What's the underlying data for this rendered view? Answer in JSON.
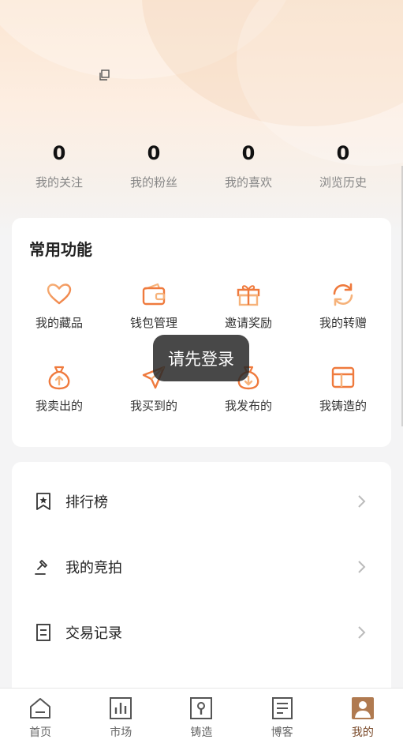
{
  "stats": [
    {
      "value": "0",
      "label": "我的关注"
    },
    {
      "value": "0",
      "label": "我的粉丝"
    },
    {
      "value": "0",
      "label": "我的喜欢"
    },
    {
      "value": "0",
      "label": "浏览历史"
    }
  ],
  "functions": {
    "title": "常用功能",
    "items": [
      {
        "label": "我的藏品",
        "icon": "heart-icon"
      },
      {
        "label": "钱包管理",
        "icon": "wallet-icon"
      },
      {
        "label": "邀请奖励",
        "icon": "gift-icon"
      },
      {
        "label": "我的转赠",
        "icon": "transfer-icon"
      },
      {
        "label": "我卖出的",
        "icon": "sold-bag-icon"
      },
      {
        "label": "我买到的",
        "icon": "send-icon"
      },
      {
        "label": "我发布的",
        "icon": "publish-bag-icon"
      },
      {
        "label": "我铸造的",
        "icon": "layout-icon"
      }
    ]
  },
  "menu": [
    {
      "label": "排行榜",
      "icon": "ranking-icon"
    },
    {
      "label": "我的竞拍",
      "icon": "auction-icon"
    },
    {
      "label": "交易记录",
      "icon": "record-icon"
    }
  ],
  "toast": "请先登录",
  "tabs": [
    {
      "label": "首页",
      "icon": "home-icon"
    },
    {
      "label": "市场",
      "icon": "market-icon"
    },
    {
      "label": "铸造",
      "icon": "mint-icon"
    },
    {
      "label": "博客",
      "icon": "blog-icon"
    },
    {
      "label": "我的",
      "icon": "profile-icon",
      "active": true
    }
  ],
  "colors": {
    "accent": "#f08a4b",
    "accent_light": "#f6b27a",
    "tab_inactive": "#666666",
    "tab_active": "#7a4a2a"
  }
}
